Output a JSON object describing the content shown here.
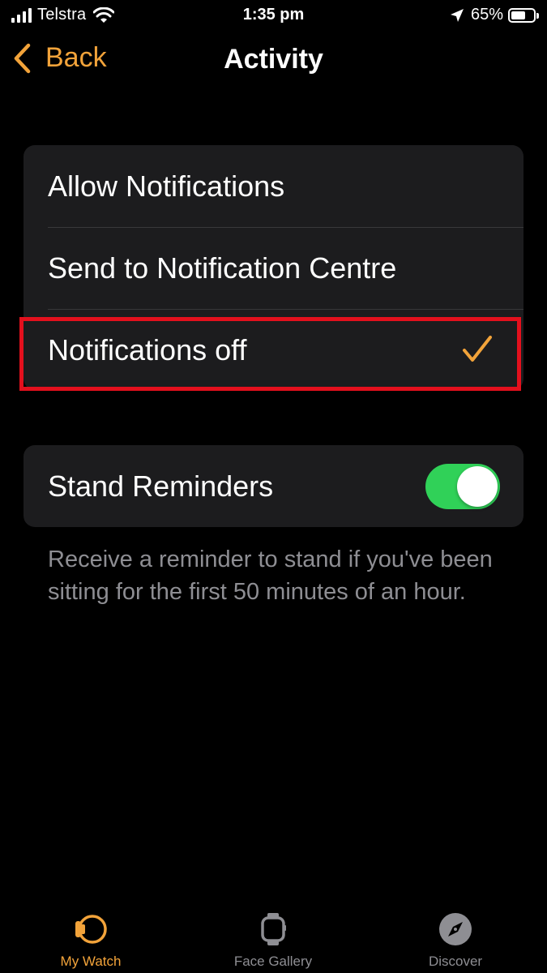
{
  "status_bar": {
    "carrier": "Telstra",
    "time": "1:35 pm",
    "battery_percent": "65%",
    "battery_level": 0.65,
    "signal_bars": 4,
    "icons": [
      "cellular-signal-icon",
      "wifi-icon",
      "location-arrow-icon",
      "battery-icon"
    ]
  },
  "nav": {
    "back_label": "Back",
    "title": "Activity"
  },
  "notification_options": {
    "items": [
      {
        "label": "Allow Notifications",
        "selected": false
      },
      {
        "label": "Send to Notification Centre",
        "selected": false
      },
      {
        "label": "Notifications off",
        "selected": true
      }
    ]
  },
  "stand_reminders": {
    "label": "Stand Reminders",
    "enabled": true,
    "footnote": "Receive a reminder to stand if you've been sitting for the first 50 minutes of an hour."
  },
  "tab_bar": {
    "active": "My Watch",
    "tabs": [
      {
        "label": "My Watch",
        "icon": "my-watch-icon"
      },
      {
        "label": "Face Gallery",
        "icon": "face-gallery-icon"
      },
      {
        "label": "Discover",
        "icon": "compass-icon"
      }
    ]
  },
  "colors": {
    "accent": "#f2a33a",
    "toggle_on": "#30d158",
    "highlight_box": "#e3101d",
    "cell_background": "#1c1c1e",
    "secondary_text": "#8e8e93"
  }
}
